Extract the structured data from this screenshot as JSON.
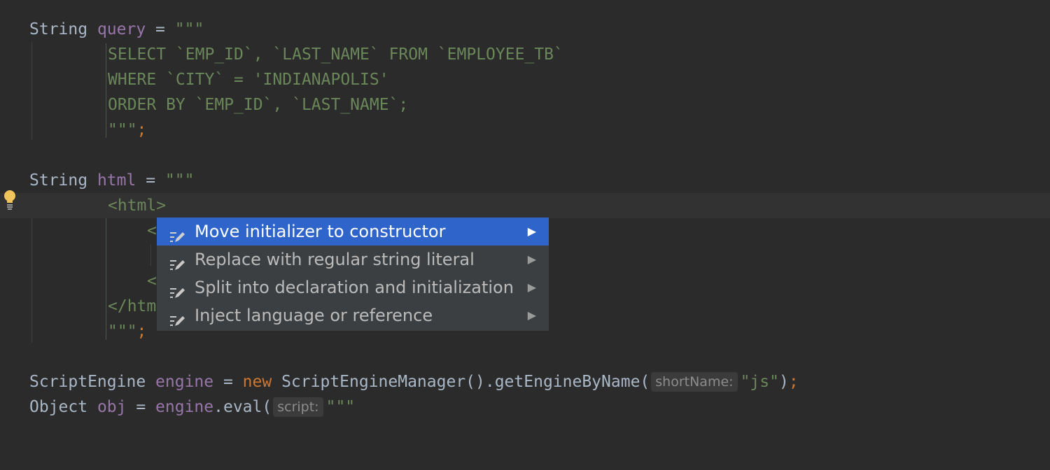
{
  "code": {
    "l1": {
      "type": "String",
      "var": "query",
      "eq": " = ",
      "open": "\"\"\""
    },
    "l2": "SELECT `EMP_ID`, `LAST_NAME` FROM `EMPLOYEE_TB`",
    "l3": "WHERE `CITY` = 'INDIANAPOLIS'",
    "l4": "ORDER BY `EMP_ID`, `LAST_NAME`;",
    "l5": {
      "close": "\"\"\"",
      "semi": ";"
    },
    "l7": {
      "type": "String",
      "var": "html",
      "eq": " = ",
      "open": "\"\"\""
    },
    "l8": "<html>",
    "l9": "<",
    "l11": "<",
    "l12": "</htm",
    "l13": {
      "close": "\"\"\"",
      "semi": ";"
    },
    "l15": {
      "type": "ScriptEngine",
      "var": "engine",
      "eq": " = ",
      "kw_new": "new",
      "call": " ScriptEngineManager().getEngineByName(",
      "hint": "shortName:",
      "arg": "\"js\"",
      "end": ")",
      "semi": ";"
    },
    "l16": {
      "type": "Object",
      "var": "obj",
      "eq": " = ",
      "obj_ref": "engine",
      "call": ".eval(",
      "hint": "script:",
      "open": "\"\"\""
    }
  },
  "popup": {
    "items": [
      {
        "label": "Move initializer to constructor",
        "selected": true
      },
      {
        "label": "Replace with regular string literal",
        "selected": false
      },
      {
        "label": "Split into declaration and initialization",
        "selected": false
      },
      {
        "label": "Inject language or reference",
        "selected": false
      }
    ],
    "item_icon": "pencil-lines-icon",
    "arrow_icon": "triangle-right-icon"
  },
  "gutter": {
    "icon": "lightbulb-icon"
  },
  "colors": {
    "background": "#2b2b2b",
    "keyword": "#cc7832",
    "variable": "#9876aa",
    "string": "#6a8759",
    "default": "#a9b7c6",
    "popup_bg": "#3c3f41",
    "popup_selected": "#2f65ca",
    "bulb": "#f2c55c"
  }
}
